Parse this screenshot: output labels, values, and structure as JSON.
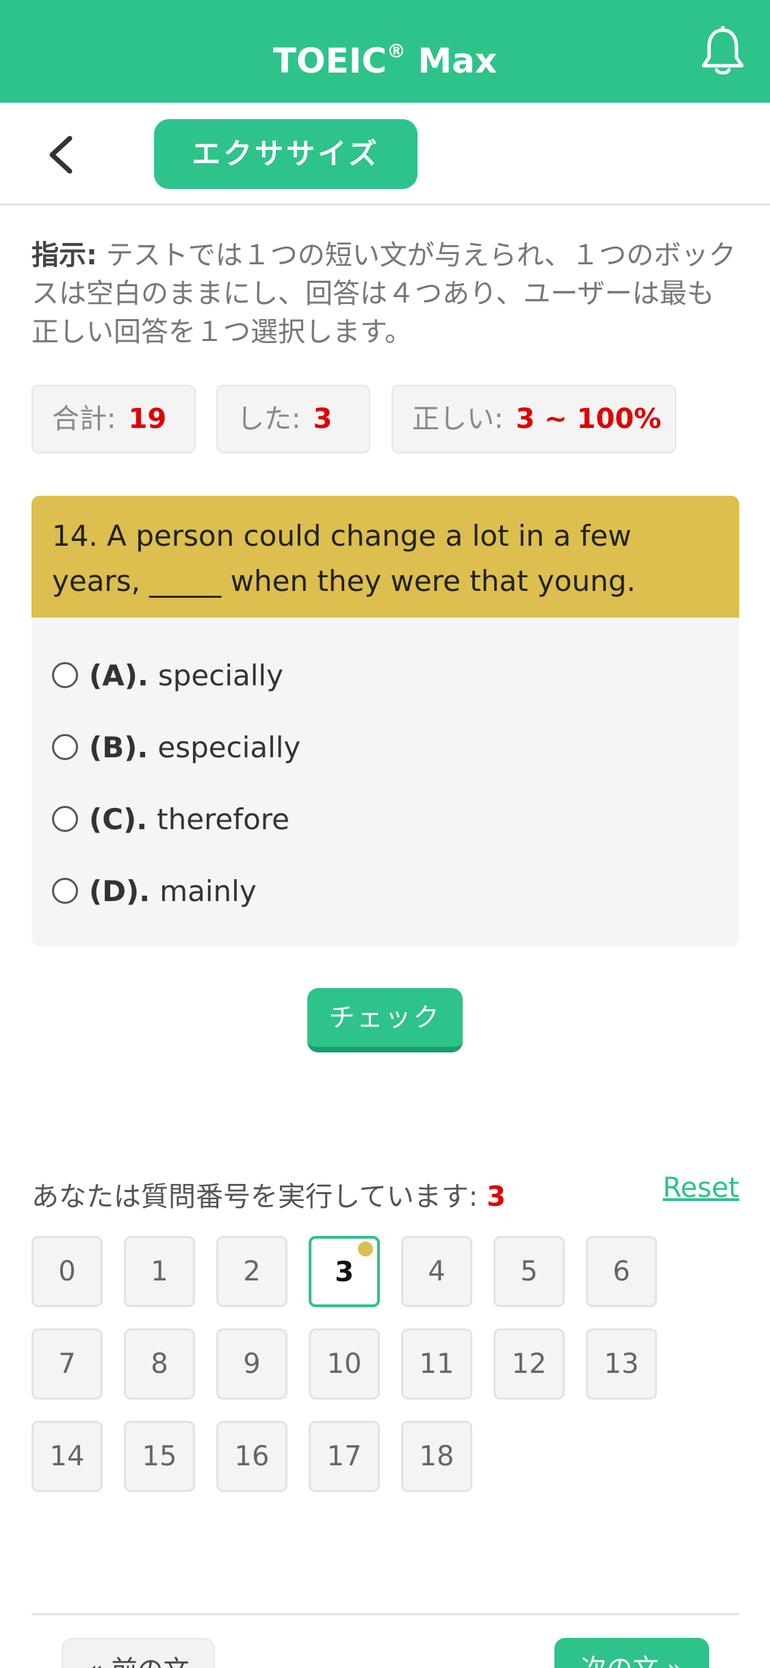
{
  "header": {
    "title": "TOEIC",
    "title_sup": "®",
    "title_suffix": " Max"
  },
  "subheader": {
    "section_label": "エクササイズ"
  },
  "instruction": {
    "label": "指示:",
    "text": " テストでは１つの短い文が与えられ、１つのボックスは空白のままにし、回答は４つあり、ユーザーは最も正しい回答を１つ選択します。"
  },
  "stats": {
    "total_label": "合計:",
    "total_value": "19",
    "done_label": "した:",
    "done_value": "3",
    "correct_label": "正しい:",
    "correct_value": "3 ~ 100%"
  },
  "question": {
    "text": "14. A person could change a lot in a few years, _____ when they were that young.",
    "options": [
      {
        "label": "(A).",
        "text": "specially"
      },
      {
        "label": "(B).",
        "text": "especially"
      },
      {
        "label": "(C).",
        "text": "therefore"
      },
      {
        "label": "(D).",
        "text": "mainly"
      }
    ]
  },
  "check_label": "チェック",
  "progress": {
    "label": "あなたは質問番号を実行しています:",
    "current": "3",
    "reset_label": "Reset"
  },
  "question_numbers": [
    "0",
    "1",
    "2",
    "3",
    "4",
    "5",
    "6",
    "7",
    "8",
    "9",
    "10",
    "11",
    "12",
    "13",
    "14",
    "15",
    "16",
    "17",
    "18"
  ],
  "active_question": "3",
  "nav": {
    "prev_label": "« 前の文",
    "next_label": "次の文 »"
  },
  "colors": {
    "brand": "#2dc38a",
    "question_bg": "#dcbf4e",
    "accent_red": "#e00000"
  }
}
